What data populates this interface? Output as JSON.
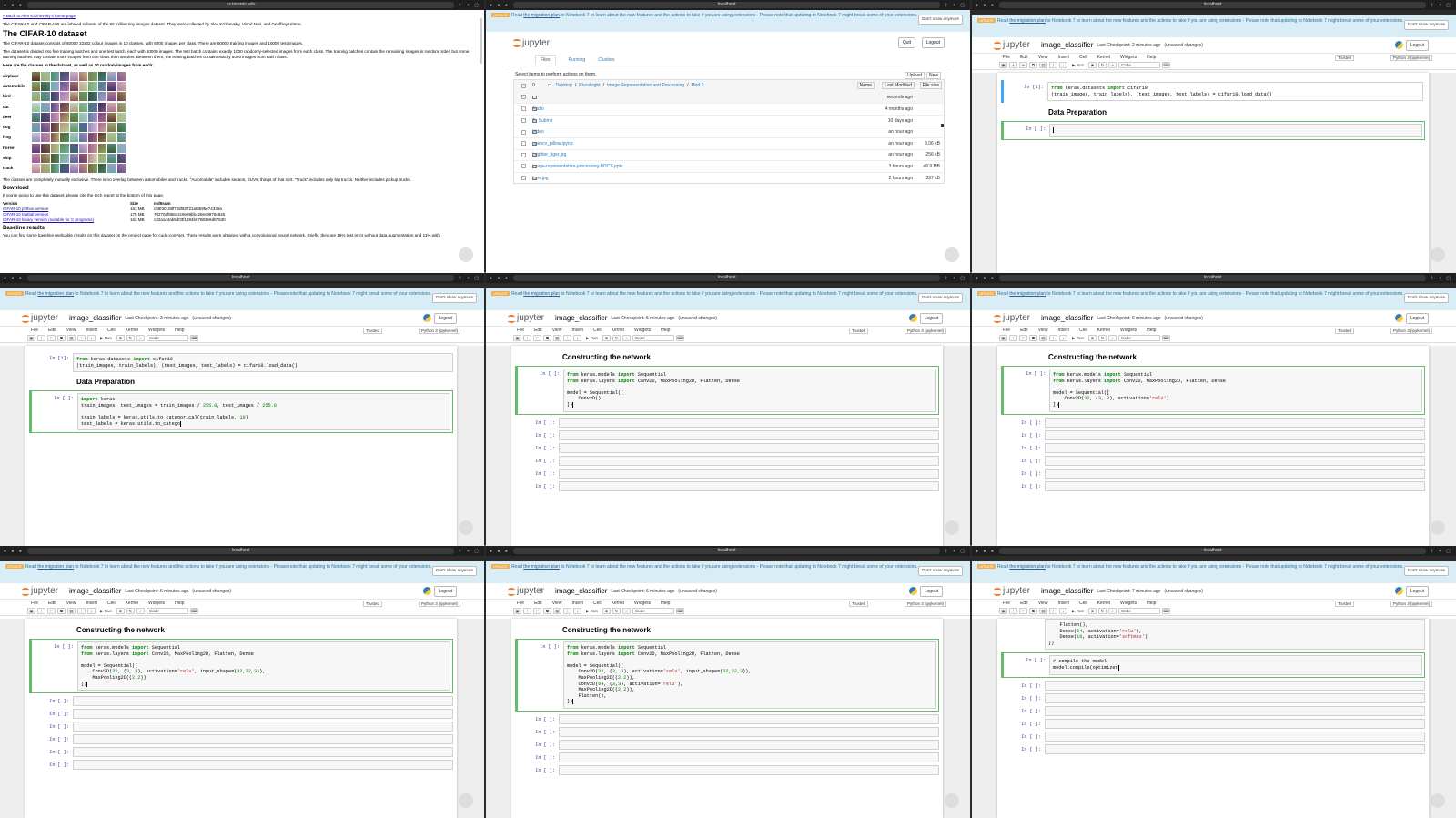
{
  "browser": {
    "tab_title": "localhost",
    "cifar_url": "cs.toronto.edu"
  },
  "banner": {
    "badge": "UPDATE",
    "text_pre": "Read ",
    "link": "the migration plan",
    "text_post": " to Notebook 7 to learn about the new features and the actions to take if you are using extensions - Please note that updating to Notebook 7 might break some of your extensions.",
    "dismiss": "Don't show anymore"
  },
  "notebook": {
    "title": "image_classifier",
    "unsaved": "(unsaved changes)",
    "logout": "Logout",
    "trusted": "Trusted",
    "kernel": "Python 3 (ipykernel)",
    "menu": [
      "File",
      "Edit",
      "View",
      "Insert",
      "Cell",
      "Kernel",
      "Widgets",
      "Help"
    ],
    "toolbar": {
      "run": "Run",
      "celltype": "Code"
    },
    "empty_prompt": "In [ ]:",
    "done_prompt": "In [1]:"
  },
  "checkpoints": {
    "t2": "Last Checkpoint: 2 minutes ago",
    "t3": "Last Checkpoint: 3 minutes ago",
    "t4": "Last Checkpoint: 5 minutes ago",
    "t5": "Last Checkpoint: 6 minutes ago",
    "t6": "Last Checkpoint: 6 minutes ago",
    "t7": "Last Checkpoint: 6 minutes ago",
    "t8": "Last Checkpoint: 7 minutes ago"
  },
  "headings": {
    "data_prep": "Data Preparation",
    "network": "Constructing the network"
  },
  "cifar": {
    "back": "« Back to Alex Krizhevsky's home page",
    "intro": "The CIFAR-10 and CIFAR-100 are labeled subsets of the 80 million tiny images dataset. They were collected by Alex Krizhevsky, Vinod Nair, and Geoffrey Hinton.",
    "title": "The CIFAR-10 dataset",
    "p1": "The CIFAR-10 dataset consists of 60000 32x32 colour images in 10 classes, with 6000 images per class. There are 50000 training images and 10000 test images.",
    "p2": "The dataset is divided into five training batches and one test batch, each with 10000 images. The test batch contains exactly 1000 randomly-selected images from each class. The training batches contain the remaining images in random order, but some training batches may contain more images from one class than another. Between them, the training batches contain exactly 5000 images from each class.",
    "p3": "Here are the classes in the dataset, as well as 10 random images from each:",
    "classes": [
      "airplane",
      "automobile",
      "bird",
      "cat",
      "deer",
      "dog",
      "frog",
      "horse",
      "ship",
      "truck"
    ],
    "p4": "The classes are completely mutually exclusive. There is no overlap between automobiles and trucks. \"Automobile\" includes sedans, SUVs, things of that sort. \"Truck\" includes only big trucks. Neither includes pickup trucks.",
    "download": "Download",
    "p5": "If you're going to use this dataset, please cite the tech report at the bottom of this page.",
    "table_head": [
      "Version",
      "Size",
      "md5sum"
    ],
    "table_rows": [
      [
        "CIFAR-10 python version",
        "163 MB",
        "c58f30108f718f92721af3b95e74349a"
      ],
      [
        "CIFAR-10 Matlab version",
        "175 MB",
        "70270af85842c9e89bb428ec9976c926"
      ],
      [
        "CIFAR-10 binary version (suitable for C programs)",
        "162 MB",
        "c32a1d4ab5d03f1284b67883e8d87530"
      ]
    ],
    "baseline": "Baseline results",
    "p6": "You can find some baseline replicable results on this dataset on the project page for cuda-convnet. These results were obtained with a convolutional neural network. Briefly, they are 18% test error without data augmentation and 11% with."
  },
  "dashboard": {
    "quit": "Quit",
    "logout": "Logout",
    "tabs": [
      "Files",
      "Running",
      "Clusters"
    ],
    "select_text": "Select items to perform actions on them.",
    "upload": "Upload",
    "new": "New",
    "count": "0",
    "crumbs": [
      "Desktop",
      "Pluralsight",
      "Image Representation and Processing",
      "Mod 3"
    ],
    "sort_name": "Name",
    "last_modified": "Last Modified",
    "file_size": "File size",
    "files": [
      {
        "name": "..",
        "mod": "seconds ago",
        "size": ""
      },
      {
        "name": "Audio",
        "mod": "4 months ago",
        "size": ""
      },
      {
        "name": "To Submit",
        "mod": "10 days ago",
        "size": ""
      },
      {
        "name": "Video",
        "mod": "an hour ago",
        "size": ""
      },
      {
        "name": "opencv_pillow.ipynb",
        "mod": "an hour ago",
        "size": "3.06 kB"
      },
      {
        "name": "brighter_tiger.jpg",
        "mod": "an hour ago",
        "size": "256 kB"
      },
      {
        "name": "image-representation-processing-M3CS.pptx",
        "mod": "3 hours ago",
        "size": "48.9 MB"
      },
      {
        "name": "tiger.jpg",
        "mod": "2 hours ago",
        "size": "397 kB"
      }
    ]
  },
  "code": {
    "import_cifar": "from keras.datasets import cifar10\n(train_images, train_labels), (test_images, test_labels) = cifar10.load_data()",
    "data_prep": "import keras\ntrain_images, test_images = train_images / 255.0, test_images / 255.0\n\ntrain_labels = keras.utils.to_categorical(train_labels, 10)\ntest_labels = keras.utils.to_catego",
    "net_a": "from keras.models import Sequential\nfrom keras.layers import Conv2D, MaxPooling2D, Flatten, Dense\n\nmodel = Sequential([\n    Conv2D()\n])",
    "net_b": "from keras.models import Sequential\nfrom keras.layers import Conv2D, MaxPooling2D, Flatten, Dense\n\nmodel = Sequential([\n    Conv2D(32, (3, 3), activation='relu')\n])",
    "net_c": "from keras.models import Sequential\nfrom keras.layers import Conv2D, MaxPooling2D, Flatten, Dense\n\nmodel = Sequential([\n    Conv2D(32, (3, 3), activation='relu', input_shape=(32,32,3)),\n    MaxPooling2D((2,2))\n])",
    "net_d": "from keras.models import Sequential\nfrom keras.layers import Conv2D, MaxPooling2D, Flatten, Dense\n\nmodel = Sequential([\n    Conv2D(32, (3, 3), activation='relu', input_shape=(32,32,3)),\n    MaxPooling2D((2,2)),\n    Conv2D(64, (3,3), activation='relu'),\n    MaxPooling2D((2,2)),\n    Flatten(),\n])",
    "net_tail": "    Flatten(),\n    Dense(64, activation='relu'),\n    Dense(10, activation='softmax')\n])",
    "compile": "# compile the model\nmodel.compile(optimizer"
  }
}
